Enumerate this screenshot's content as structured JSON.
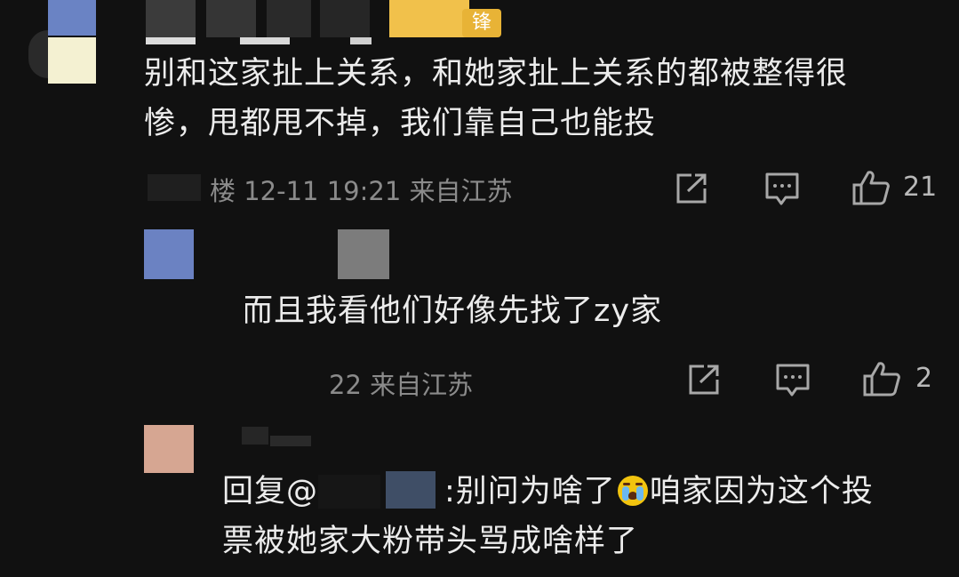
{
  "comments": [
    {
      "text_line1": "别和这家扯上关系，和她家扯上关系的都被整得很",
      "text_line2": "惨，甩都甩不掉，我们靠自己也能投",
      "meta": "楼 12-11 19:21 来自江苏",
      "like_count": "21",
      "username_badge": "锋"
    },
    {
      "text": "而且我看他们好像先找了zy家",
      "meta": "22 来自江苏",
      "like_count": "2"
    },
    {
      "text_line1_prefix": "回复@",
      "text_line1_mid": ":别问为啥了",
      "text_line1_suffix": "咱家因为这个投",
      "text_line2": "票被她家大粉带头骂成啥样了"
    }
  ],
  "icons": {
    "share": "share-icon",
    "comment": "comment-icon",
    "like": "thumbs-up-icon",
    "emoji": "loudly-crying-emoji"
  },
  "colors": {
    "background": "#111111",
    "text": "#ececec",
    "meta": "#8b8b8b"
  }
}
